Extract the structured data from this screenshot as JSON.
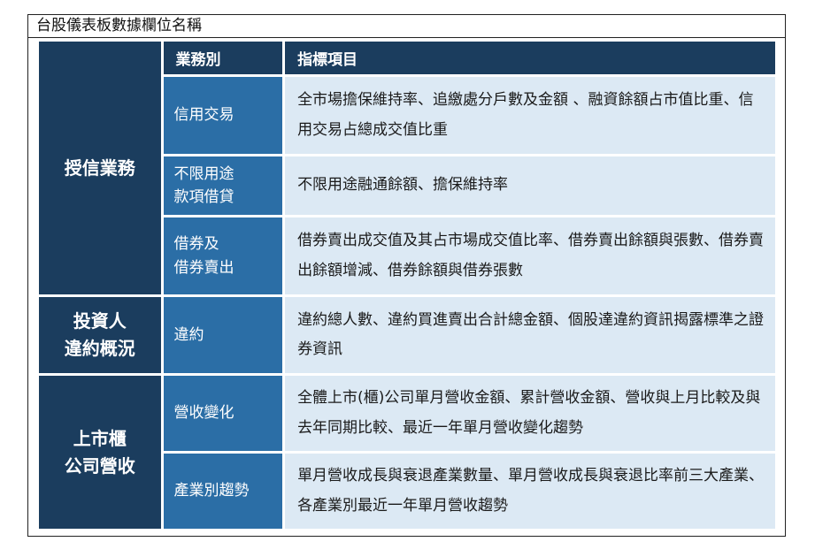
{
  "title": "台股儀表板數據欄位名稱",
  "headers": {
    "business": "業務別",
    "indicators": "指標項目"
  },
  "groups": [
    {
      "category_lines": [
        "授信業務"
      ],
      "rows": [
        {
          "business_lines": [
            "信用交易"
          ],
          "indicators": "全市場擔保維持率、追繳處分戶數及金額 、融資餘額占市值比重、信用交易占總成交值比重"
        },
        {
          "business_lines": [
            "不限用途",
            "款項借貸"
          ],
          "indicators": "不限用途融通餘額、擔保維持率"
        },
        {
          "business_lines": [
            "借券及",
            "借券賣出"
          ],
          "indicators": "借券賣出成交值及其占市場成交值比率、借券賣出餘額與張數、借券賣出餘額增減、借券餘額與借券張數"
        }
      ]
    },
    {
      "category_lines": [
        "投資人",
        "違約概況"
      ],
      "rows": [
        {
          "business_lines": [
            "違約"
          ],
          "indicators": "違約總人數、違約買進賣出合計總金額、個股達違約資訊揭露標準之證券資訊"
        }
      ]
    },
    {
      "category_lines": [
        "上市櫃",
        "公司營收"
      ],
      "rows": [
        {
          "business_lines": [
            "營收變化"
          ],
          "indicators": "全體上市(櫃)公司單月營收金額、累計營收金額、營收與上月比較及與去年同期比較、最近一年單月營收變化趨勢"
        },
        {
          "business_lines": [
            "產業別趨勢"
          ],
          "indicators": "單月營收成長與衰退產業數量、單月營收成長與衰退比率前三大產業、各產業別最近一年單月營收趨勢"
        }
      ]
    }
  ]
}
